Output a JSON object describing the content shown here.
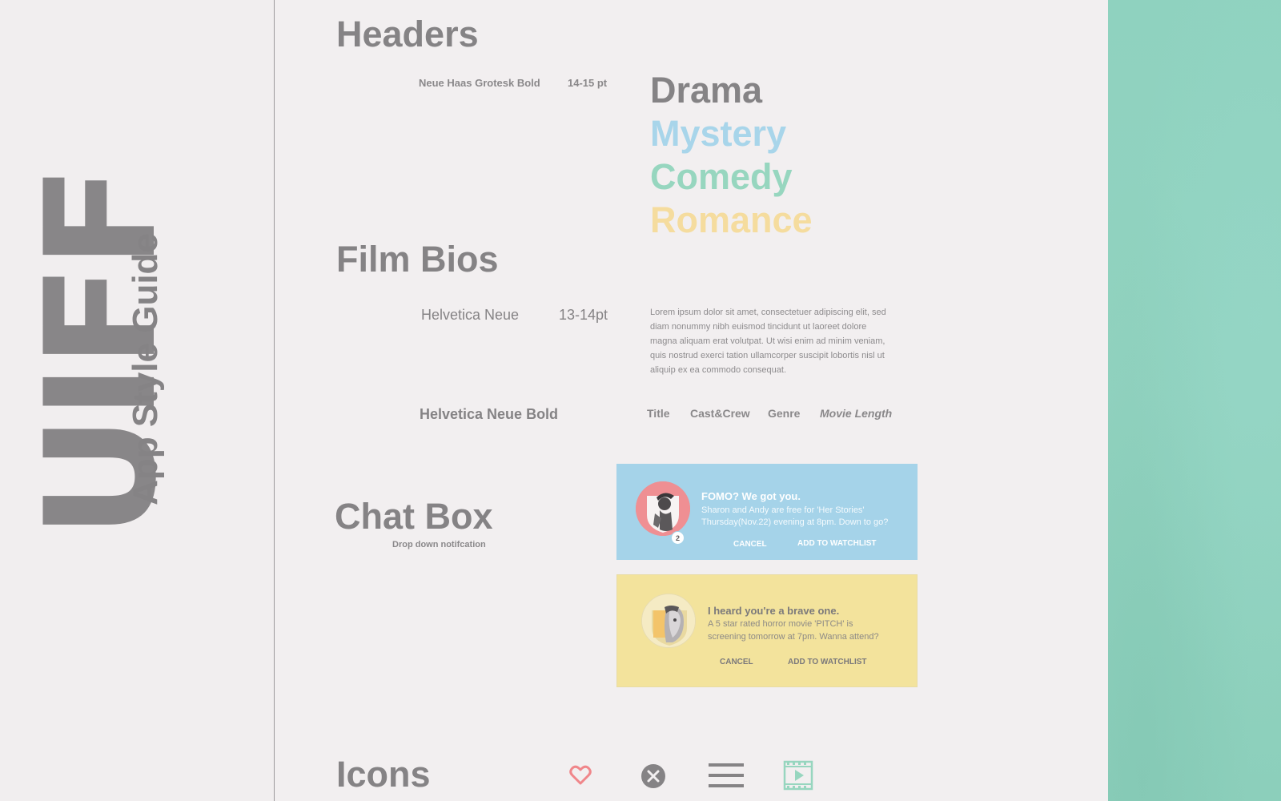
{
  "branding": {
    "logo_text": "UIFF",
    "subtitle": "App Style Guide"
  },
  "headers": {
    "title": "Headers",
    "font_name": "Neue Haas Grotesk Bold",
    "font_size": "14-15 pt",
    "genres": [
      {
        "label": "Drama",
        "color": "#858385"
      },
      {
        "label": "Mystery",
        "color": "#a8d5ea"
      },
      {
        "label": "Comedy",
        "color": "#97d6bf"
      },
      {
        "label": "Romance",
        "color": "#f5dc9e"
      }
    ]
  },
  "film_bios": {
    "title": "Film Bios",
    "font_name": "Helvetica Neue",
    "font_size": "13-14pt",
    "lorem": "Lorem ipsum dolor sit amet, consectetuer adipiscing elit, sed diam nonummy nibh euismod tincidunt ut laoreet dolore magna aliquam erat volutpat. Ut wisi enim ad minim veniam, quis nostrud exerci tation ullamcorper suscipit lobortis nisl ut aliquip ex ea commodo consequat.",
    "bold_font_name": "Helvetica Neue Bold",
    "fields": [
      "Title",
      "Cast&Crew",
      "Genre",
      "Movie Length"
    ]
  },
  "chat_box": {
    "title": "Chat Box",
    "caption": "Drop down notifcation",
    "notifications": [
      {
        "style": "blue",
        "title": "FOMO? We got you.",
        "body_line1": "Sharon and Andy are free for 'Her Stories'",
        "body_line2": "Thursday(Nov.22) evening at 8pm. Down to go?",
        "badge": "2",
        "cancel": "CANCEL",
        "add": "ADD TO WATCHLIST",
        "bg": "#a5d3e9"
      },
      {
        "style": "yellow",
        "title": "I heard you're a brave one.",
        "body_line1": "A 5 star rated horror movie 'PITCH' is",
        "body_line2": "screening tomorrow at 7pm. Wanna attend?",
        "cancel": "CANCEL",
        "add": "ADD TO WATCHLIST",
        "bg": "#f3e39c"
      }
    ]
  },
  "icons_section": {
    "title": "Icons",
    "icons": [
      {
        "name": "heart-icon",
        "color": "#f0868a"
      },
      {
        "name": "close-icon",
        "color": "#858385"
      },
      {
        "name": "menu-icon",
        "color": "#858385"
      },
      {
        "name": "play-film-icon",
        "color": "#97d6bf"
      }
    ]
  },
  "colors": {
    "background": "#f2eff0",
    "text_gray": "#858385",
    "teal_panel": "#8fd2bf"
  }
}
